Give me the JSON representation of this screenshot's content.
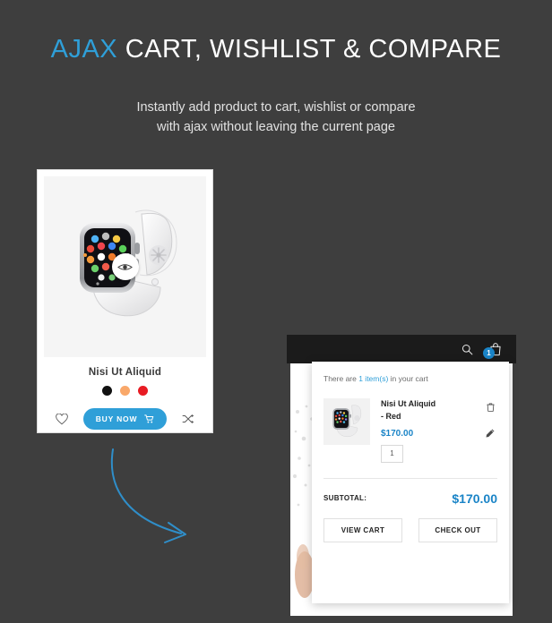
{
  "hero": {
    "title_accent": "AJAX",
    "title_rest": " CART, WISHLIST & COMPARE",
    "subtitle_line1": "Instantly add product to cart, wishlist or compare",
    "subtitle_line2": "with ajax without leaving the current page"
  },
  "colors": {
    "background": "#3e3e3e",
    "accent_blue": "#2f9fd8",
    "badge_blue": "#1a84c7",
    "card_white": "#ffffff",
    "topbar_dark": "#1b1b1b"
  },
  "product": {
    "name": "Nisi Ut Aliquid",
    "quickview_icon": "eye-icon",
    "swatches": [
      {
        "name": "black",
        "hex": "#111111"
      },
      {
        "name": "orange",
        "hex": "#f9a濃"
      },
      {
        "name": "red",
        "hex": "#e81b23"
      }
    ],
    "wishlist_icon": "heart-icon",
    "buy_label": "BUY NOW",
    "buy_icon": "cart-icon",
    "compare_icon": "compare-icon"
  },
  "mockup": {
    "topbar": {
      "search_icon": "search-icon",
      "bag_icon": "shopping-bag-icon",
      "bag_count": "1"
    },
    "cart": {
      "note_prefix": "There are ",
      "note_highlight": "1 item(s)",
      "note_suffix": " in your cart",
      "item": {
        "title": "Nisi Ut Aliquid - Red",
        "price": "$170.00",
        "quantity": "1",
        "remove_icon": "trash-icon",
        "edit_icon": "pencil-icon"
      },
      "subtotal_label": "SUBTOTAL:",
      "subtotal_value": "$170.00",
      "view_cart_label": "VIEW CART",
      "checkout_label": "CHECK OUT"
    }
  },
  "decoration": {
    "arrow": "curved-arrow-icon"
  }
}
